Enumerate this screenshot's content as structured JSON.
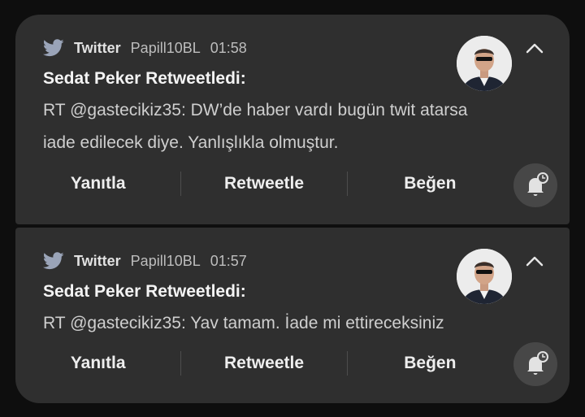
{
  "notifications": [
    {
      "app": "Twitter",
      "account": "Papill10BL",
      "time": "01:58",
      "title": "Sedat Peker Retweetledi:",
      "lines": [
        "RT @gastecikiz35: DW’de haber vardı bugün twit atarsa",
        "iade edilecek diye. Yanlışlıkla olmuştur."
      ],
      "actions": [
        "Yanıtla",
        "Retweetle",
        "Beğen"
      ]
    },
    {
      "app": "Twitter",
      "account": "Papill10BL",
      "time": "01:57",
      "title": "Sedat Peker Retweetledi:",
      "lines": [
        "RT @gastecikiz35: Yav tamam. İade mi ettireceksiniz"
      ],
      "actions": [
        "Yanıtla",
        "Retweetle",
        "Beğen"
      ]
    }
  ],
  "icons": {
    "app_icon": "twitter-bird-icon",
    "expand": "chevron-up-icon",
    "snooze": "bell-snooze-icon"
  },
  "colors": {
    "background": "#0e0e0e",
    "card": "#2f2f2f",
    "title": "#f4f4f4",
    "body": "#cfcfcf",
    "meta": "#bdbdbd"
  }
}
